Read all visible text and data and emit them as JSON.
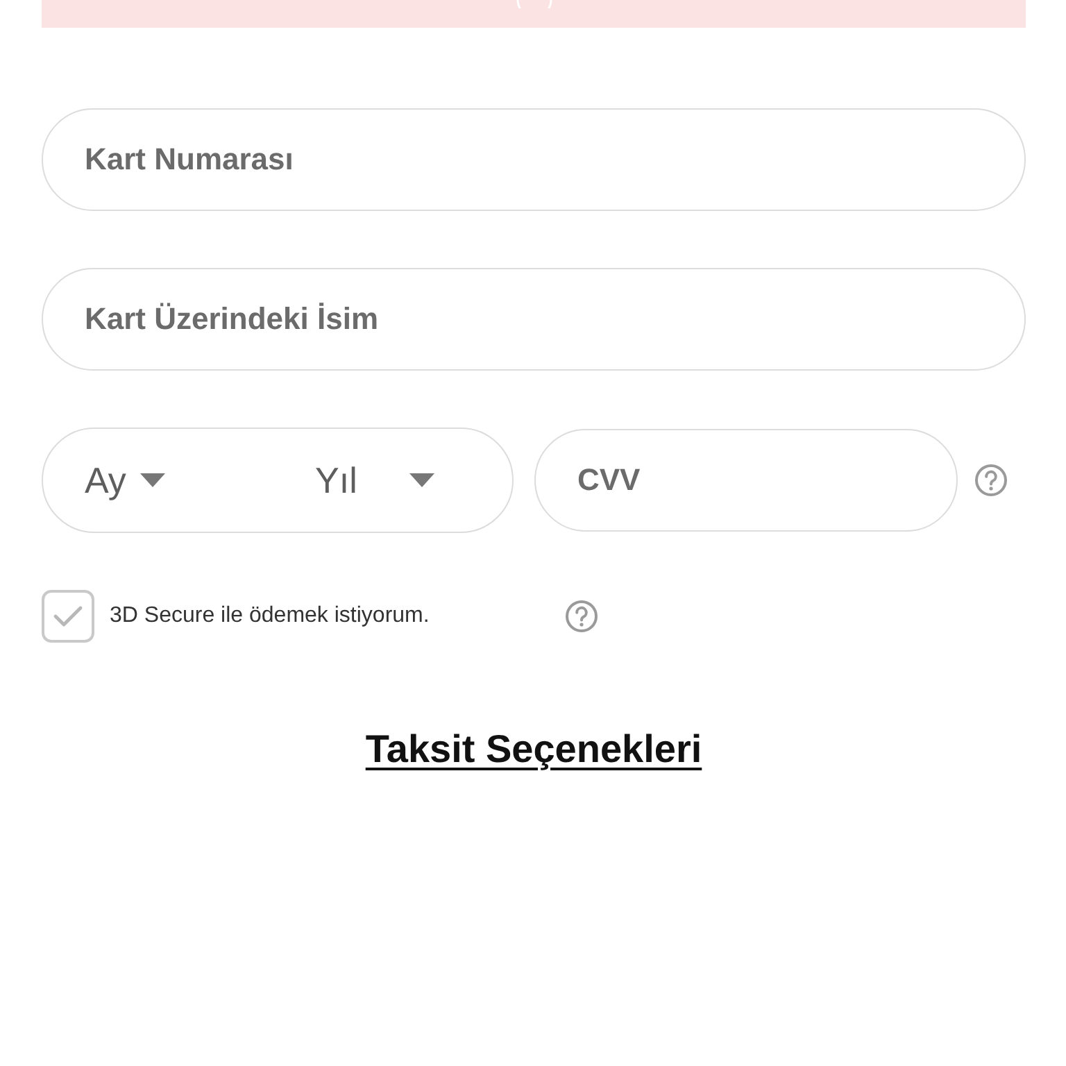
{
  "fields": [
    {
      "placeholder": "Kart Numarası"
    },
    {
      "placeholder": "Kart Üzerindeki İsim"
    }
  ],
  "expiry": {
    "month": {
      "label": "Ay"
    },
    "year": {
      "label": "Yıl"
    }
  },
  "cvv": {
    "placeholder": "CVV"
  },
  "secure_option": {
    "label": "3D Secure ile ödemek istiyorum.",
    "checked": true
  },
  "installments_link": "Taksit Seçenekleri"
}
